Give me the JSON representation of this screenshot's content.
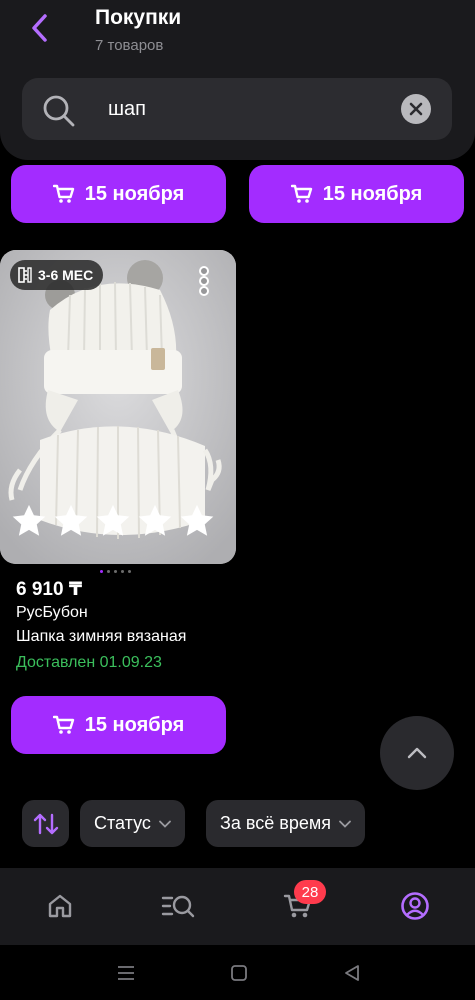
{
  "header": {
    "title": "Покупки",
    "subtitle": "7 товаров"
  },
  "search": {
    "value": "шап",
    "placeholder": ""
  },
  "delivery_buttons": {
    "label_1": "15 ноября",
    "label_2": "15 ноября",
    "label_3": "15 ноября"
  },
  "product": {
    "age_badge": "3-6 МЕС",
    "price": "6 910 ₸",
    "seller": "РусБубон",
    "name": "Шапка зимняя вязаная",
    "status": "Доставлен 01.09.23",
    "rating": 5,
    "rating_max": 5,
    "image_count": 5,
    "active_image": 1
  },
  "filters": {
    "status_label": "Статус",
    "period_label": "За всё время"
  },
  "bottom_nav": {
    "cart_badge": "28"
  },
  "colors": {
    "accent": "#a32cff",
    "status_green": "#3bbf5c",
    "badge_red": "#ff3b4d"
  },
  "icons": {
    "back": "chevron-left-icon",
    "search": "search-icon",
    "clear": "clear-icon",
    "cart": "cart-icon",
    "age": "ruler-icon",
    "more": "more-vertical-icon",
    "scroll_top": "chevron-up-icon",
    "sort": "sort-icon",
    "home": "home-icon",
    "catalog": "catalog-search-icon",
    "profile": "profile-icon"
  }
}
